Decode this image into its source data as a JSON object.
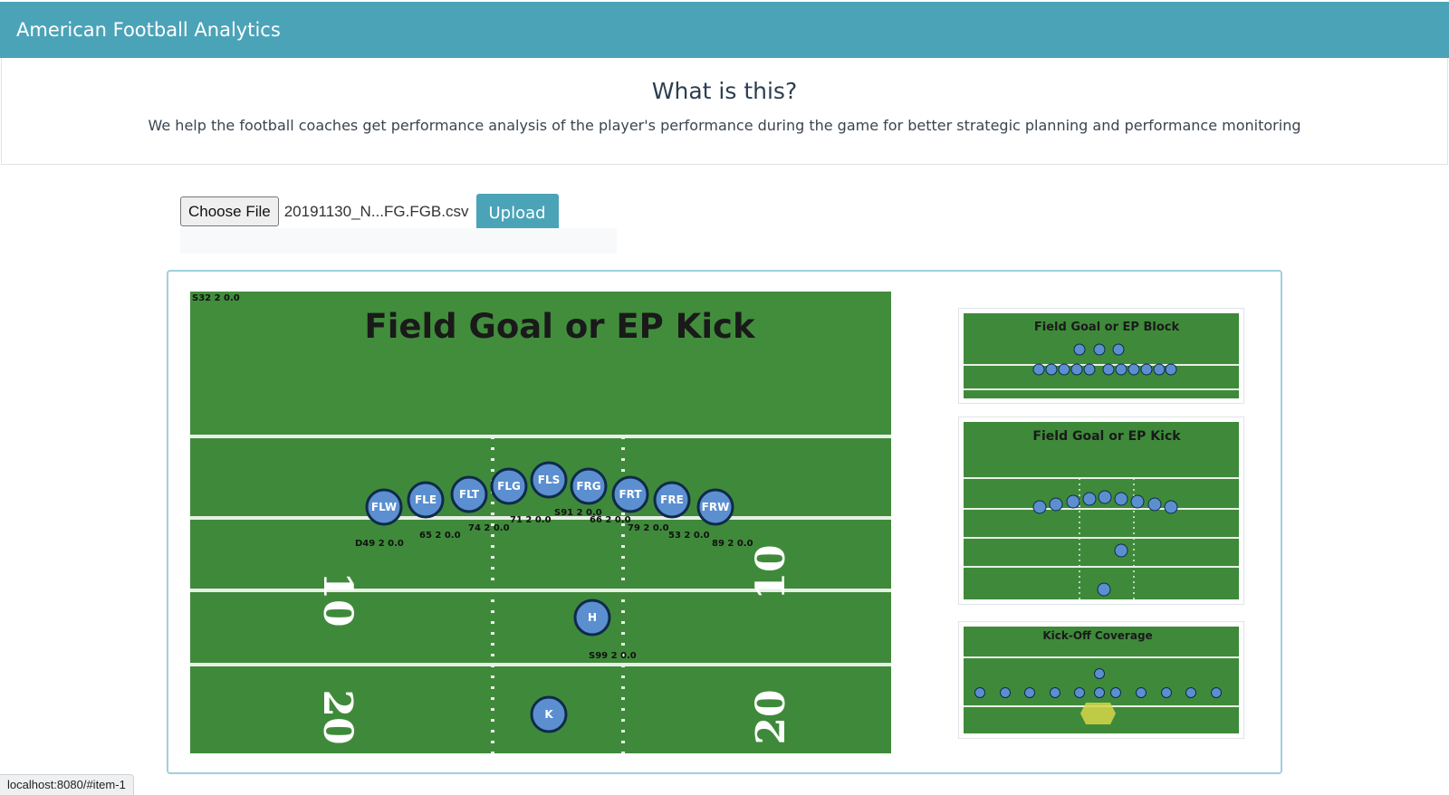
{
  "header": {
    "brand": "American Football Analytics"
  },
  "intro": {
    "heading": "What is this?",
    "description": "We help the football coaches get performance analysis of the player's performance during the game for better strategic planning and performance monitoring"
  },
  "upload": {
    "choose_label": "Choose File",
    "file_name": "20191130_N...FG.FGB.csv",
    "upload_label": "Upload"
  },
  "main_image": {
    "corner_label": "S32 2 0.0",
    "title": "Field Goal or EP Kick",
    "players": [
      {
        "id": "FLW",
        "label": "D49 2 0.0"
      },
      {
        "id": "FLE",
        "label": "65 2 0.0"
      },
      {
        "id": "FLT",
        "label": "74 2 0.0"
      },
      {
        "id": "FLG",
        "label": "71 2 0.0"
      },
      {
        "id": "FLS",
        "label": "S91 2 0.0"
      },
      {
        "id": "FRG",
        "label": "66 2 0.0"
      },
      {
        "id": "FRT",
        "label": "79 2 0.0"
      },
      {
        "id": "FRE",
        "label": "53 2 0.0"
      },
      {
        "id": "FRW",
        "label": "89 2 0.0"
      },
      {
        "id": "H",
        "label": "S99 2 0.0"
      },
      {
        "id": "K",
        "label": ""
      }
    ],
    "yard_numbers": {
      "left_top": "10",
      "left_bottom": "20",
      "right_top": "10",
      "right_bottom": "20"
    }
  },
  "thumbnails": [
    {
      "title": "Field Goal or EP Block"
    },
    {
      "title": "Field Goal or EP Kick"
    },
    {
      "title": "Kick-Off Coverage"
    }
  ],
  "status_bar": {
    "url": "localhost:8080/#item-1"
  },
  "colors": {
    "accent": "#4ba3b8",
    "field": "#3f8a3a",
    "player": "#5b8fd0"
  }
}
